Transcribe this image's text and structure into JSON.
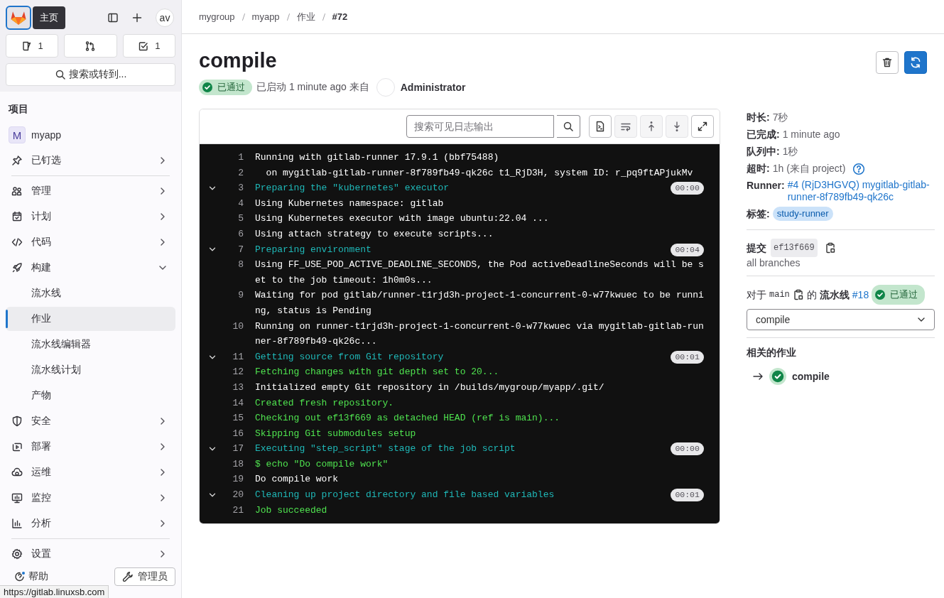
{
  "tooltip": "主页",
  "sidebar": {
    "avatar": "av",
    "counters": [
      {
        "kind": "issues",
        "count": "1"
      },
      {
        "kind": "merge_requests"
      },
      {
        "kind": "todos",
        "count": "1"
      }
    ],
    "search": "搜索或转到...",
    "section_title": "项目",
    "groups": [
      [
        {
          "kind": "project",
          "avatar": "M",
          "label": "myapp"
        },
        {
          "kind": "pinned",
          "label": "已钉选",
          "expanded": false
        }
      ],
      [
        {
          "kind": "manage",
          "label": "管理",
          "expanded": false
        },
        {
          "kind": "plan",
          "label": "计划",
          "expanded": false
        },
        {
          "kind": "code",
          "label": "代码",
          "expanded": false
        },
        {
          "kind": "build",
          "label": "构建",
          "expanded": true,
          "children": [
            {
              "label": "流水线",
              "selected": false
            },
            {
              "label": "作业",
              "selected": true
            },
            {
              "label": "流水线编辑器",
              "selected": false
            },
            {
              "label": "流水线计划",
              "selected": false
            },
            {
              "label": "产物",
              "selected": false
            }
          ]
        },
        {
          "kind": "secure",
          "label": "安全",
          "expanded": false
        },
        {
          "kind": "deploy",
          "label": "部署",
          "expanded": false
        },
        {
          "kind": "operate",
          "label": "运维",
          "expanded": false
        },
        {
          "kind": "monitor",
          "label": "监控",
          "expanded": false
        },
        {
          "kind": "analyze",
          "label": "分析",
          "expanded": false
        }
      ],
      [
        {
          "kind": "settings",
          "label": "设置",
          "expanded": false
        }
      ]
    ],
    "help": "帮助",
    "admin": "管理员"
  },
  "status_url": "https://gitlab.linuxsb.com",
  "breadcrumbs": [
    {
      "label": "mygroup",
      "current": false
    },
    {
      "label": "myapp",
      "current": false
    },
    {
      "label": "作业",
      "current": false
    },
    {
      "label": "#72",
      "current": true
    }
  ],
  "job": {
    "title": "compile",
    "status": "已通过",
    "started": "已启动 1 minute ago 来自",
    "user": "Administrator"
  },
  "log": {
    "search_placeholder": "搜索可见日志输出",
    "tools": [
      {
        "kind": "raw",
        "disabled": false
      },
      {
        "kind": "wrap",
        "disabled": true
      },
      {
        "kind": "top",
        "disabled": true
      },
      {
        "kind": "bottom",
        "disabled": true
      },
      {
        "kind": "fullscreen",
        "disabled": false
      }
    ],
    "lines": [
      {
        "n": "1",
        "kind": "plain",
        "text": "Running with gitlab-runner 17.9.1 (bbf75488)"
      },
      {
        "n": "2",
        "kind": "plain",
        "text": "  on mygitlab-gitlab-runner-8f789fb49-qk26c t1_RjD3H, system ID: r_pq9ftAPjukMv"
      },
      {
        "n": "3",
        "kind": "section",
        "text": "Preparing the \"kubernetes\" executor",
        "duration": "00:00"
      },
      {
        "n": "4",
        "kind": "plain",
        "text": "Using Kubernetes namespace: gitlab"
      },
      {
        "n": "5",
        "kind": "plain",
        "text": "Using Kubernetes executor with image ubuntu:22.04 ..."
      },
      {
        "n": "6",
        "kind": "plain",
        "text": "Using attach strategy to execute scripts..."
      },
      {
        "n": "7",
        "kind": "section",
        "text": "Preparing environment",
        "duration": "00:04"
      },
      {
        "n": "8",
        "kind": "plain",
        "text": "Using FF_USE_POD_ACTIVE_DEADLINE_SECONDS, the Pod activeDeadlineSeconds will be set to the job timeout: 1h0m0s..."
      },
      {
        "n": "9",
        "kind": "plain",
        "text": "Waiting for pod gitlab/runner-t1rjd3h-project-1-concurrent-0-w77kwuec to be running, status is Pending"
      },
      {
        "n": "10",
        "kind": "plain",
        "text": "Running on runner-t1rjd3h-project-1-concurrent-0-w77kwuec via mygitlab-gitlab-runner-8f789fb49-qk26c..."
      },
      {
        "n": "11",
        "kind": "section",
        "text": "Getting source from Git repository",
        "duration": "00:01"
      },
      {
        "n": "12",
        "kind": "success",
        "text": "Fetching changes with git depth set to 20..."
      },
      {
        "n": "13",
        "kind": "plain",
        "text": "Initialized empty Git repository in /builds/mygroup/myapp/.git/"
      },
      {
        "n": "14",
        "kind": "success",
        "text": "Created fresh repository."
      },
      {
        "n": "15",
        "kind": "success",
        "text": "Checking out ef13f669 as detached HEAD (ref is main)..."
      },
      {
        "n": "16",
        "kind": "success",
        "text": "Skipping Git submodules setup"
      },
      {
        "n": "17",
        "kind": "section",
        "text": "Executing \"step_script\" stage of the job script",
        "duration": "00:00"
      },
      {
        "n": "18",
        "kind": "success",
        "text": "$ echo \"Do compile work\""
      },
      {
        "n": "19",
        "kind": "plain",
        "text": "Do compile work"
      },
      {
        "n": "20",
        "kind": "section",
        "text": "Cleaning up project directory and file based variables",
        "duration": "00:01"
      },
      {
        "n": "21",
        "kind": "success",
        "text": "Job succeeded"
      }
    ]
  },
  "details": {
    "rows": [
      {
        "kind": "text",
        "label": "时长:",
        "value": "7秒"
      },
      {
        "kind": "text",
        "label": "已完成:",
        "value": "1 minute ago"
      },
      {
        "kind": "text",
        "label": "队列中:",
        "value": "1秒"
      },
      {
        "kind": "help",
        "label": "超时:",
        "value": "1h (来自 project)"
      },
      {
        "kind": "link",
        "label": "Runner:",
        "value": "#4 (RjD3HGVQ) mygitlab-gitlab-runner-8f789fb49-qk26c"
      },
      {
        "kind": "tag",
        "label": "标签:",
        "value": "study-runner"
      }
    ]
  },
  "commit": {
    "label": "提交",
    "sha": "ef13f669",
    "branches": "all branches"
  },
  "pipeline": {
    "prefix": "对于",
    "ref": "main",
    "of": "的",
    "label": "流水线",
    "id": "#18",
    "status": "已通过"
  },
  "job_select": "compile",
  "related": {
    "title": "相关的作业",
    "jobs": [
      {
        "name": "compile",
        "current": true
      }
    ]
  }
}
